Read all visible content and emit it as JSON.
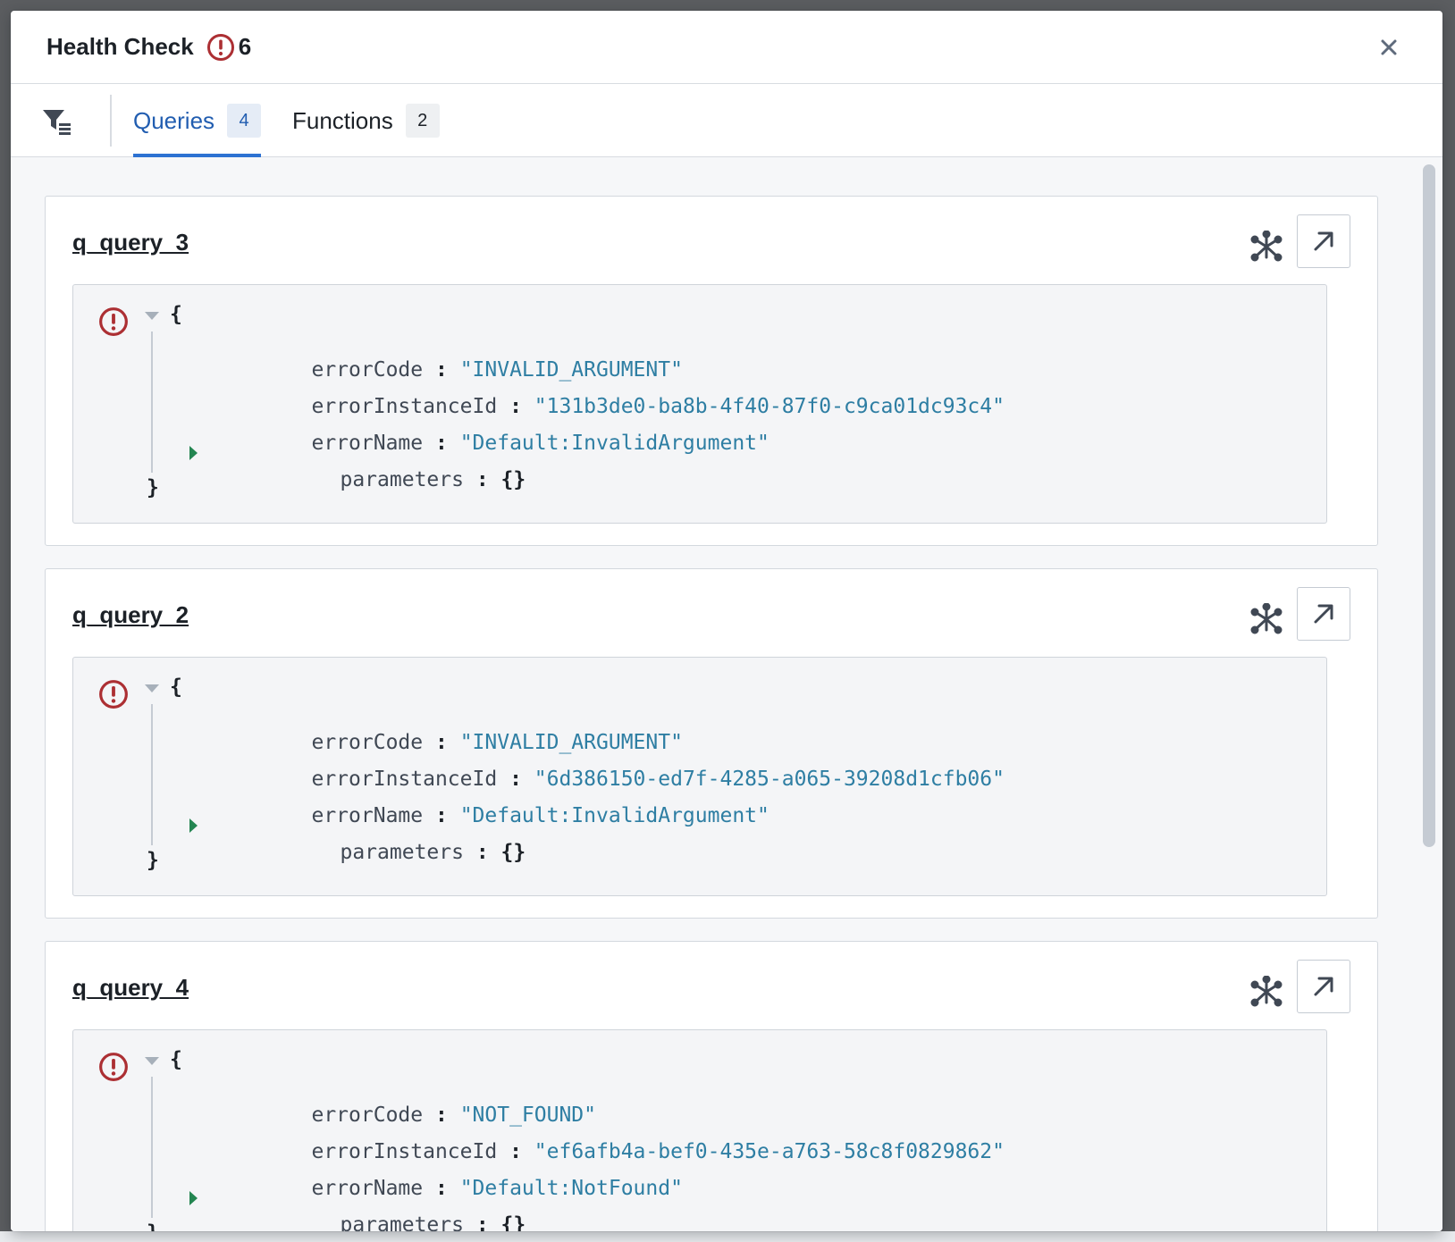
{
  "dialog": {
    "title": "Health Check",
    "error_count": "6",
    "close_icon": "close-icon"
  },
  "tabs": [
    {
      "label": "Queries",
      "count": "4",
      "active": true
    },
    {
      "label": "Functions",
      "count": "2",
      "active": false
    }
  ],
  "colors": {
    "accent": "#215db0",
    "error": "#ac2f33",
    "json_value": "#2e7ea3",
    "expand_caret": "#238551"
  },
  "cards": [
    {
      "title": "q_query_3",
      "json": {
        "open": "{",
        "close": "}",
        "rows": [
          {
            "key": "errorCode",
            "sep": ":",
            "value": "\"INVALID_ARGUMENT\""
          },
          {
            "key": "errorInstanceId",
            "sep": ":",
            "value": "\"131b3de0-ba8b-4f40-87f0-c9ca01dc93c4\""
          },
          {
            "key": "errorName",
            "sep": ":",
            "value": "\"Default:InvalidArgument\""
          }
        ],
        "param_key": "parameters",
        "param_sep": ":",
        "param_value": "{}"
      }
    },
    {
      "title": "q_query_2",
      "json": {
        "open": "{",
        "close": "}",
        "rows": [
          {
            "key": "errorCode",
            "sep": ":",
            "value": "\"INVALID_ARGUMENT\""
          },
          {
            "key": "errorInstanceId",
            "sep": ":",
            "value": "\"6d386150-ed7f-4285-a065-39208d1cfb06\""
          },
          {
            "key": "errorName",
            "sep": ":",
            "value": "\"Default:InvalidArgument\""
          }
        ],
        "param_key": "parameters",
        "param_sep": ":",
        "param_value": "{}"
      }
    },
    {
      "title": "q_query_4",
      "json": {
        "open": "{",
        "close": "}",
        "rows": [
          {
            "key": "errorCode",
            "sep": ":",
            "value": "\"NOT_FOUND\""
          },
          {
            "key": "errorInstanceId",
            "sep": ":",
            "value": "\"ef6afb4a-bef0-435e-a763-58c8f0829862\""
          },
          {
            "key": "errorName",
            "sep": ":",
            "value": "\"Default:NotFound\""
          }
        ],
        "param_key": "parameters",
        "param_sep": ":",
        "param_value": "{}"
      }
    }
  ]
}
